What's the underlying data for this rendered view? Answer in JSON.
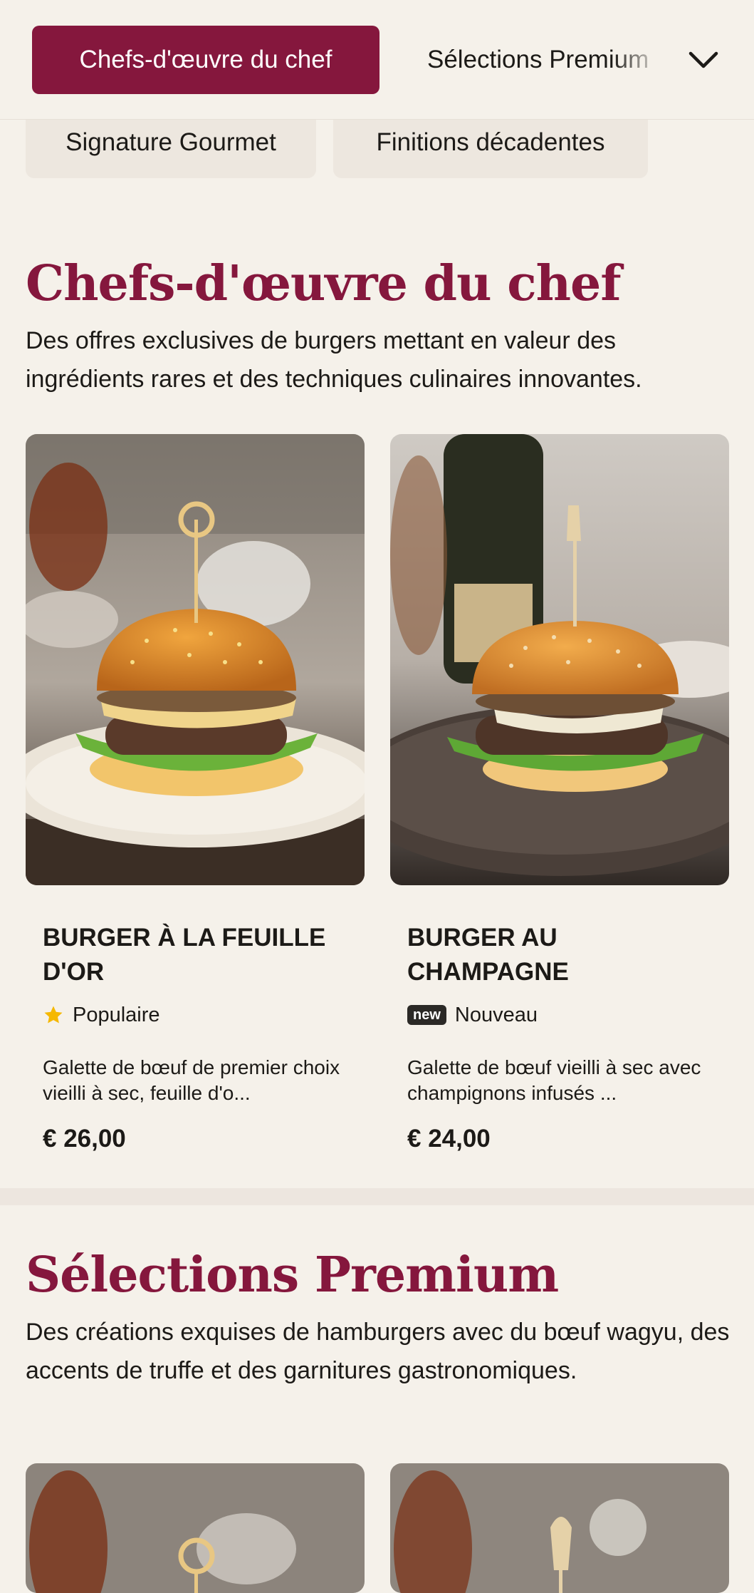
{
  "tabs": {
    "active": "Chefs-d'œuvre du chef",
    "next": "Sélections Premium"
  },
  "subcategories": [
    "Signature Gourmet",
    "Finitions décadentes"
  ],
  "sections": [
    {
      "title": "Chefs-d'œuvre du chef",
      "description": "Des offres exclusives de burgers mettant en valeur des ingrédients rares et des techniques culinaires innovantes.",
      "items": [
        {
          "name": "BURGER À LA FEUILLE D'OR",
          "badge_icon": "star-icon",
          "badge_label": "Populaire",
          "description": "Galette de bœuf de premier choix vieilli à sec, feuille d'o...",
          "price": "€ 26,00"
        },
        {
          "name": "BURGER AU CHAMPAGNE",
          "badge_icon": "new-badge-icon",
          "badge_pill": "new",
          "badge_label": "Nouveau",
          "description": "Galette de bœuf vieilli à sec avec champignons infusés ...",
          "price": "€ 24,00"
        }
      ]
    },
    {
      "title": "Sélections Premium",
      "description": "Des créations exquises de hamburgers avec du bœuf wagyu, des accents de truffe et des garnitures gastronomiques."
    }
  ],
  "colors": {
    "accent": "#85173d",
    "background": "#f5f1ea",
    "chip": "#ede7df",
    "star": "#f5b800"
  }
}
